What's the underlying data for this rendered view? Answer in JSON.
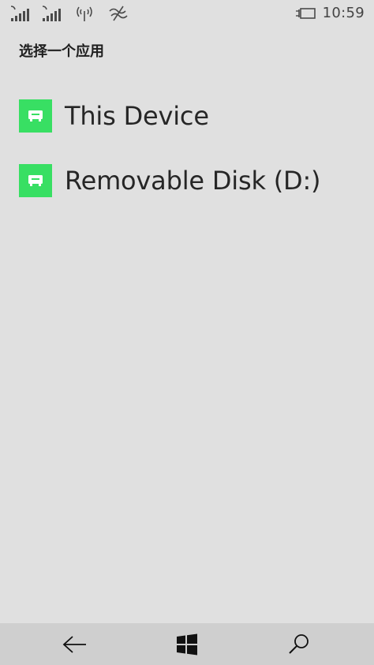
{
  "status_bar": {
    "time": "10:59",
    "icons": [
      "signal-sim1-icon",
      "signal-sim2-icon",
      "network-icon",
      "wifi-icon",
      "battery-charging-icon"
    ]
  },
  "page": {
    "title": "选择一个应用"
  },
  "apps": [
    {
      "label": "This Device",
      "icon": "drive-icon",
      "tile_color": "#38df63"
    },
    {
      "label": "Removable Disk (D:)",
      "icon": "drive-icon",
      "tile_color": "#38df63"
    }
  ],
  "nav_bar": {
    "buttons": [
      "back-icon",
      "windows-start-icon",
      "search-icon"
    ]
  }
}
